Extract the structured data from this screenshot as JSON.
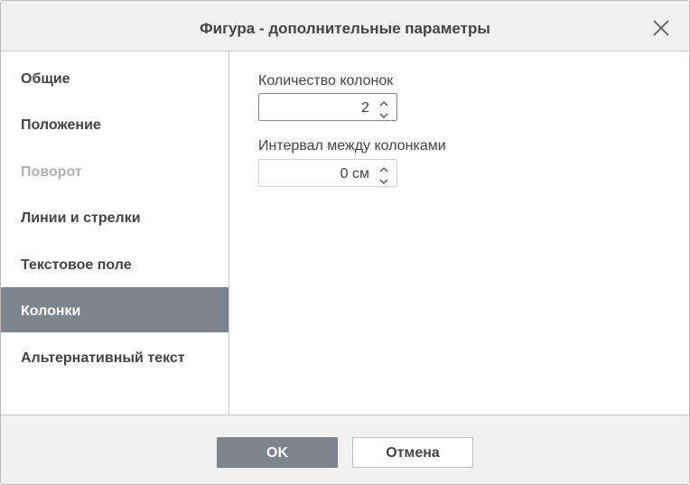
{
  "dialog": {
    "title": "Фигура - дополнительные параметры"
  },
  "sidebar": {
    "items": [
      {
        "label": "Общие",
        "state": "normal"
      },
      {
        "label": "Положение",
        "state": "normal"
      },
      {
        "label": "Поворот",
        "state": "disabled"
      },
      {
        "label": "Линии и стрелки",
        "state": "normal"
      },
      {
        "label": "Текстовое поле",
        "state": "normal"
      },
      {
        "label": "Колонки",
        "state": "active"
      },
      {
        "label": "Альтернативный текст",
        "state": "normal"
      }
    ]
  },
  "columns": {
    "count_label": "Количество колонок",
    "count_value": "2",
    "spacing_label": "Интервал между колонками",
    "spacing_value": "0 см"
  },
  "footer": {
    "ok_label": "OK",
    "cancel_label": "Отмена"
  },
  "colors": {
    "accent": "#7d858c",
    "text": "#444444",
    "disabled_text": "#b0b0b0",
    "header_bg": "#f1f1f1"
  },
  "icons": {
    "close": "close-icon",
    "spin_up": "chevron-up-icon",
    "spin_down": "chevron-down-icon"
  }
}
